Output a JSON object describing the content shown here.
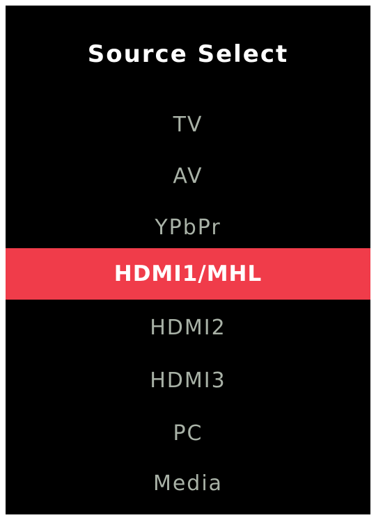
{
  "title": "Source Select",
  "items": [
    {
      "label": "TV"
    },
    {
      "label": "AV"
    },
    {
      "label": "YPbPr"
    },
    {
      "label": "HDMI1/MHL"
    },
    {
      "label": "HDMI2"
    },
    {
      "label": "HDMI3"
    },
    {
      "label": "PC"
    },
    {
      "label": "Media"
    }
  ],
  "selected_index": 3,
  "colors": {
    "background": "#000000",
    "highlight": "#f03c4a",
    "item_text": "#a9b2a7",
    "selected_text": "#ffffff"
  }
}
